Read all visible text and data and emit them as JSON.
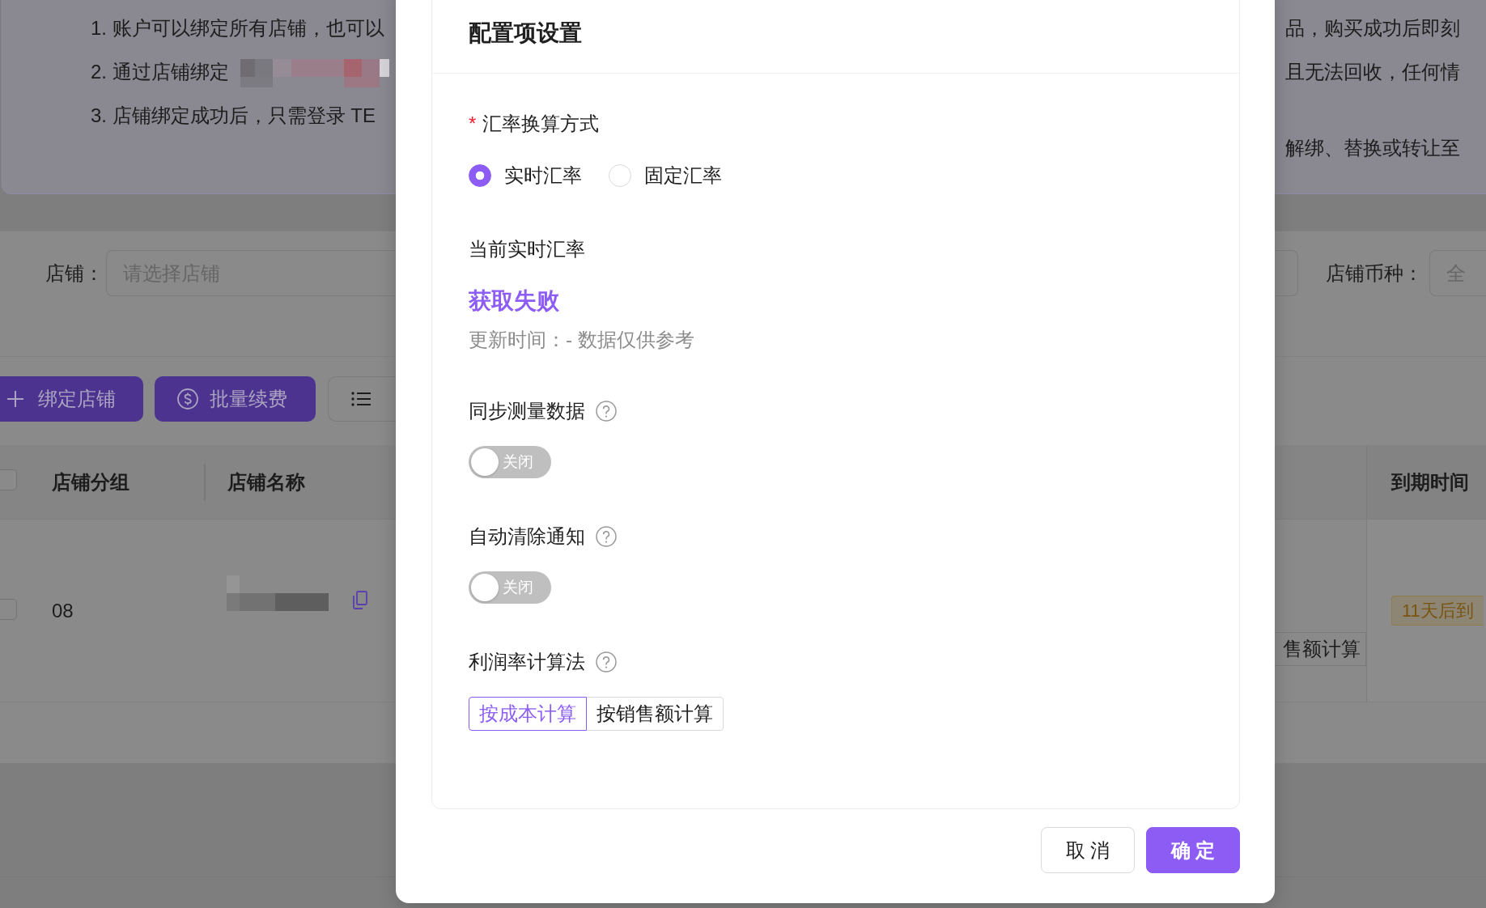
{
  "notice": {
    "left_lines": [
      {
        "text": "1. 账户可以绑定所有店铺，也可以",
        "redacted": false
      },
      {
        "text": "2. 通过店铺绑定",
        "redacted": true
      },
      {
        "text": "3. 店铺绑定成功后，只需登录 TE",
        "redacted": false
      }
    ],
    "right_lines": [
      "品，购买成功后即刻",
      "且无法回收，任何情",
      "解绑、替换或转让至"
    ]
  },
  "filters": {
    "store": {
      "label": "店铺：",
      "placeholder": "请选择店铺"
    },
    "currency": {
      "label": "店铺币种：",
      "placeholder": "全"
    }
  },
  "toolbar": [
    {
      "kind": "add",
      "label": "绑定店铺"
    },
    {
      "kind": "renew",
      "label": "批量续费"
    },
    {
      "kind": "list"
    }
  ],
  "table": {
    "header_checked": false,
    "columns": [
      "店铺分组",
      "店铺名称"
    ],
    "fixed_column": "到期时间",
    "rows": [
      {
        "checked": false,
        "group": "08",
        "name_redacted": true,
        "calc_method": "售额计算",
        "expiry": "11天后到"
      }
    ]
  },
  "dialog": {
    "title": "配置项设置",
    "rate_mode": {
      "required_mark": "*",
      "label": "汇率换算方式",
      "options": [
        {
          "label": "实时汇率",
          "selected": true
        },
        {
          "label": "固定汇率",
          "selected": false
        }
      ]
    },
    "current_rate": {
      "label": "当前实时汇率",
      "value": "获取失败",
      "note": "更新时间：- 数据仅供参考"
    },
    "switches": [
      {
        "label": "同步测量数据",
        "help": true,
        "on": false,
        "state_text": "关闭"
      },
      {
        "label": "自动清除通知",
        "help": true,
        "on": false,
        "state_text": "关闭"
      }
    ],
    "profit_method": {
      "label": "利润率计算法",
      "help": true,
      "options": [
        {
          "label": "按成本计算",
          "selected": true
        },
        {
          "label": "按销售额计算",
          "selected": false
        }
      ]
    },
    "buttons": [
      {
        "kind": "cancel",
        "label": "取 消"
      },
      {
        "kind": "confirm",
        "label": "确 定"
      }
    ]
  }
}
